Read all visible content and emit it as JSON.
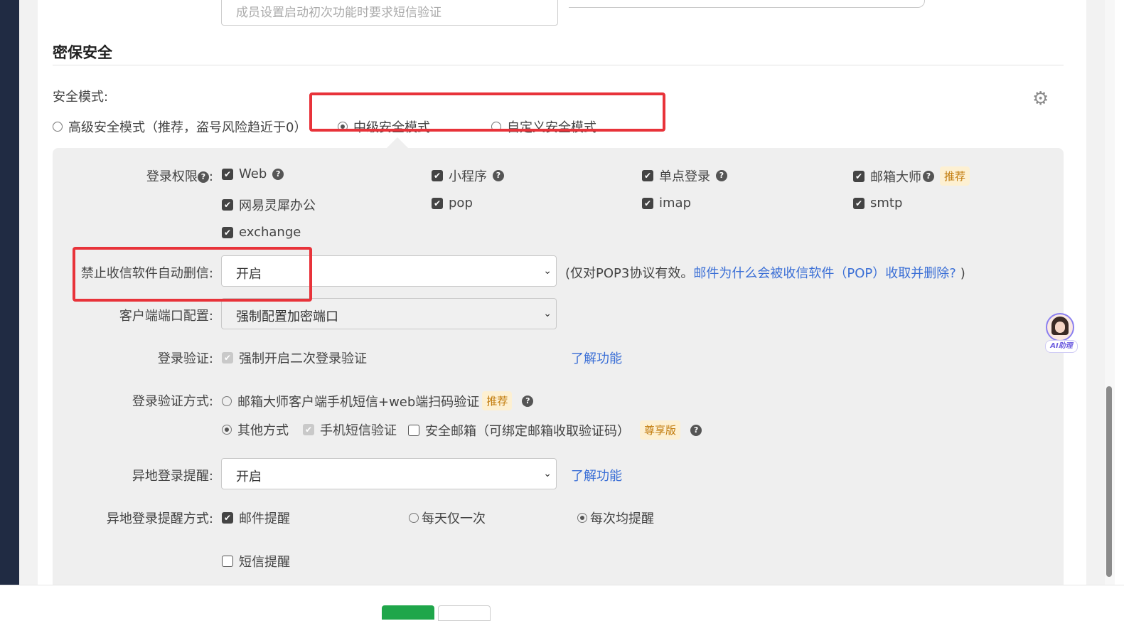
{
  "top_field": {
    "text": "成员设置启动初次功能时要求短信验证"
  },
  "section": {
    "title": "密保安全"
  },
  "security_mode": {
    "label": "安全模式:",
    "options": [
      {
        "label": "高级安全模式（推荐，盗号风险趋近于0）",
        "selected": false
      },
      {
        "label": "中级安全模式",
        "selected": true
      },
      {
        "label": "自定义安全模式",
        "selected": false
      }
    ]
  },
  "login_permissions": {
    "label": "登录权限",
    "colon": ":",
    "items": [
      {
        "label": "Web",
        "checked": true
      },
      {
        "label": "小程序",
        "checked": true
      },
      {
        "label": "单点登录",
        "checked": true
      },
      {
        "label": "邮箱大师",
        "checked": true,
        "badge": "推荐"
      },
      {
        "label": "网易灵犀办公",
        "checked": true
      },
      {
        "label": "pop",
        "checked": true
      },
      {
        "label": "imap",
        "checked": true
      },
      {
        "label": "smtp",
        "checked": true
      },
      {
        "label": "exchange",
        "checked": true
      }
    ]
  },
  "auto_delete": {
    "label": "禁止收信软件自动删信:",
    "value": "开启",
    "note_prefix": "(仅对POP3协议有效。",
    "note_link": "邮件为什么会被收信软件（POP）收取并删除?",
    "note_suffix": ")"
  },
  "client_port": {
    "label": "客户端端口配置:",
    "value": "强制配置加密端口"
  },
  "login_verify": {
    "label": "登录验证:",
    "checkbox_label": "强制开启二次登录验证",
    "link": "了解功能"
  },
  "verify_method": {
    "label": "登录验证方式:",
    "option1": "邮箱大师客户端手机短信+web端扫码验证",
    "option1_badge": "推荐",
    "option2": "其他方式",
    "sms": "手机短信验证",
    "secure_mail": "安全邮箱（可绑定邮箱收取验证码）",
    "option2_badge": "尊享版"
  },
  "remote_login_alert": {
    "label": "异地登录提醒:",
    "value": "开启",
    "link": "了解功能"
  },
  "alert_method": {
    "label": "异地登录提醒方式:",
    "mail": "邮件提醒",
    "daily": "每天仅一次",
    "every": "每次均提醒",
    "sms": "短信提醒"
  },
  "assistant": {
    "label": "AI助理"
  },
  "icons": {
    "gear": "gear-icon",
    "help": "question-icon",
    "chevron": "chevron-down-icon"
  }
}
